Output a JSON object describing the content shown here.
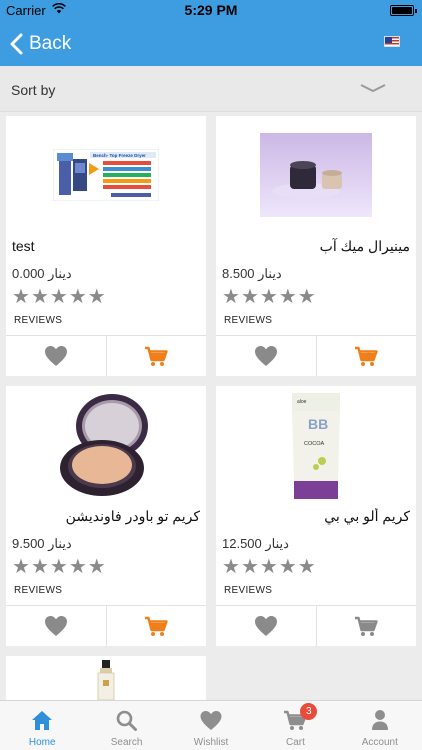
{
  "status_bar": {
    "carrier": "Carrier",
    "time": "5:29 PM"
  },
  "nav": {
    "back_label": "Back"
  },
  "sort": {
    "label": "Sort by"
  },
  "products": [
    {
      "name": "test",
      "price": "0.000 دينار",
      "reviews_label": "REVIEWS",
      "rating": 5,
      "image": "freeze-dryer-brochure"
    },
    {
      "name": "مينيرال ميك آب",
      "price": "8.500 دينار",
      "reviews_label": "REVIEWS",
      "rating": 5,
      "image": "mineral-makeup-jar"
    },
    {
      "name": "كريم تو باودر فاونديشن",
      "price": "9.500 دينار",
      "reviews_label": "REVIEWS",
      "rating": 5,
      "image": "compact-powder"
    },
    {
      "name": "كريم ألو بي بي",
      "price": "12.500 دينار",
      "reviews_label": "REVIEWS",
      "rating": 5,
      "image": "bb-cream-tube"
    },
    {
      "name": "",
      "price": "",
      "reviews_label": "",
      "rating": 0,
      "image": "lotion-bottle"
    }
  ],
  "freeze_dryer_brochure": {
    "heading": "Bench- Top Freeze Dryer"
  },
  "bb_tube": {
    "brand": "aloe",
    "logo": "BB",
    "line": "COCOA"
  },
  "tabs": [
    {
      "label": "Home",
      "icon": "home-icon",
      "active": true
    },
    {
      "label": "Search",
      "icon": "search-icon",
      "active": false
    },
    {
      "label": "Wishlist",
      "icon": "heart-icon",
      "active": false
    },
    {
      "label": "Cart",
      "icon": "cart-icon",
      "active": false,
      "badge": "3"
    },
    {
      "label": "Account",
      "icon": "account-icon",
      "active": false
    }
  ],
  "colors": {
    "primary": "#3d9de0",
    "cart_active": "#f07f1a",
    "cart_disabled": "#8a8a8a",
    "star": "#8a8a8a",
    "badge": "#e84c3d"
  }
}
